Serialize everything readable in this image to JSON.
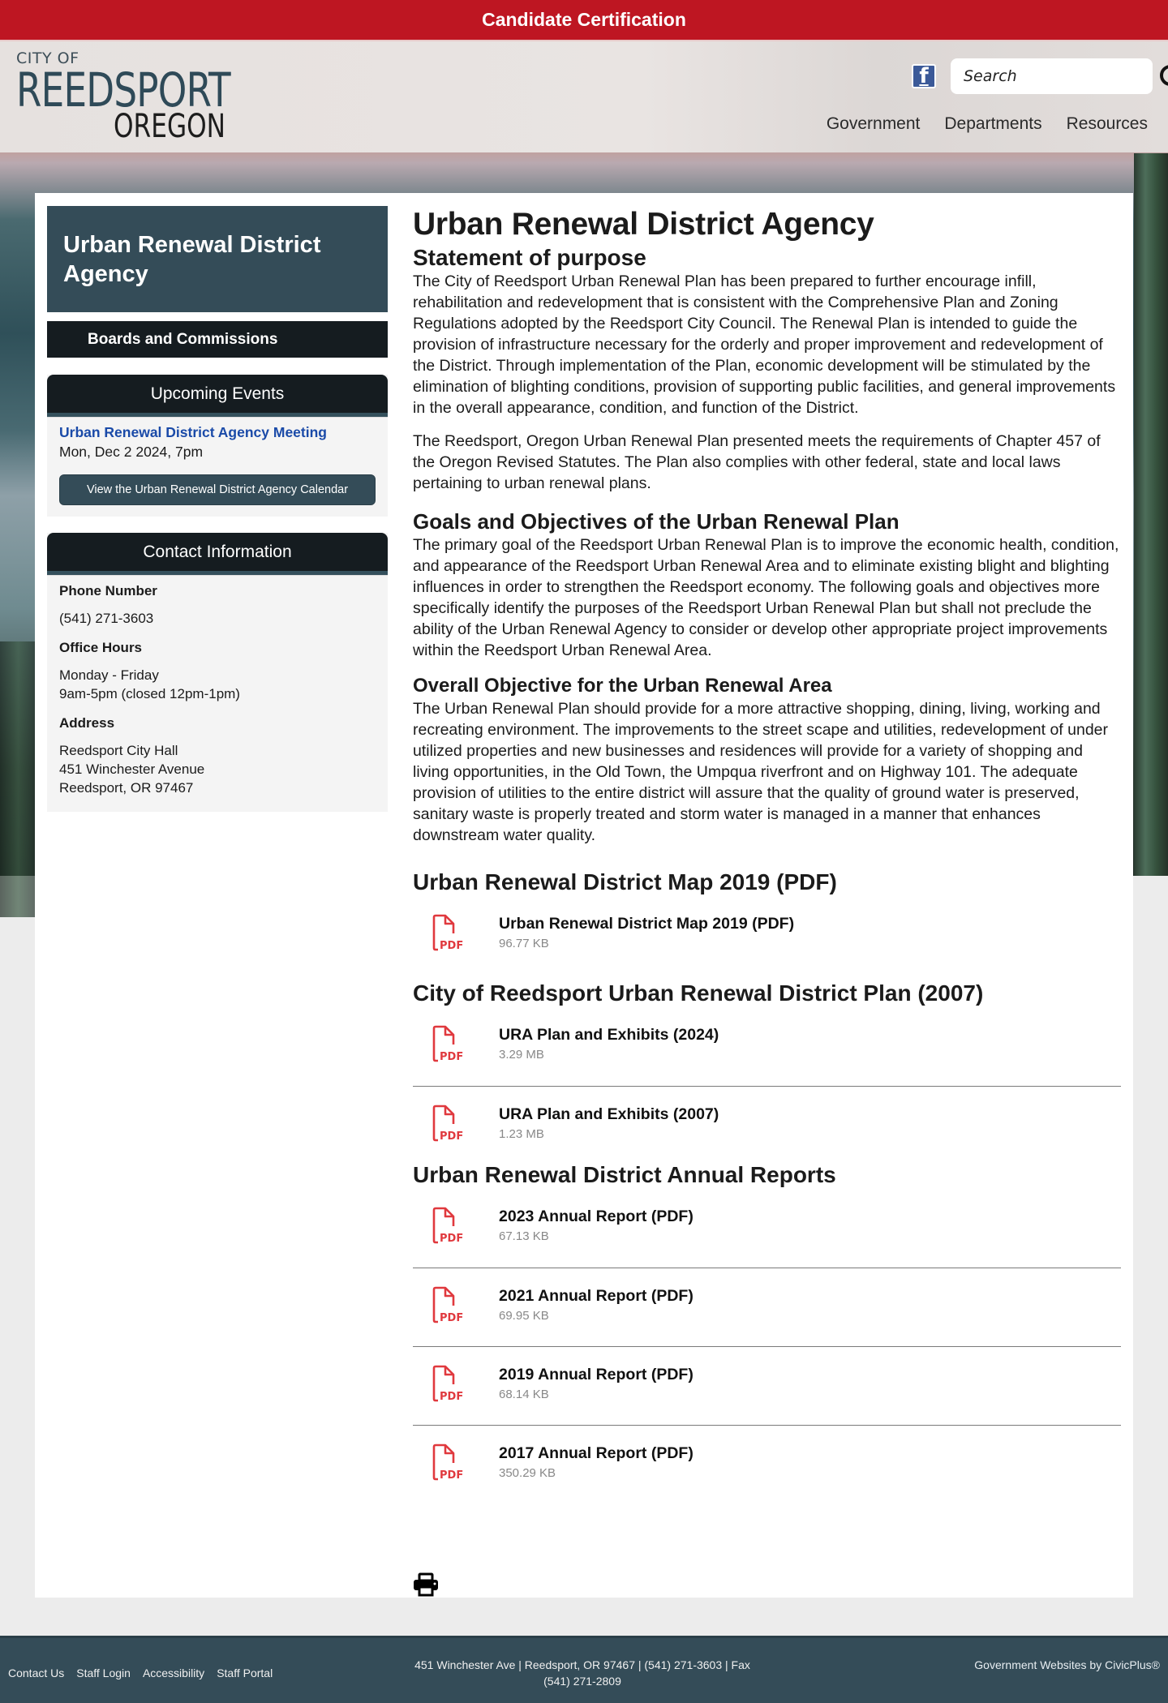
{
  "alert": {
    "label": "Candidate Certification",
    "color": "#be1622"
  },
  "logo": {
    "line1": "CITY OF",
    "line2": "REEDSPORT",
    "line3": "OREGON"
  },
  "header": {
    "social_icon": "facebook-icon",
    "search": {
      "placeholder": "Search",
      "value": "",
      "icon": "search-icon"
    },
    "nav": [
      "Government",
      "Departments",
      "Resources"
    ]
  },
  "sidebar": {
    "title": "Urban Renewal District Agency",
    "link": "Boards and Commissions",
    "events": {
      "heading": "Upcoming Events",
      "items": [
        {
          "title": "Urban Renewal District Agency Meeting",
          "date": "Mon, Dec 2 2024, 7pm"
        }
      ],
      "button": "View the Urban Renewal District Agency Calendar"
    },
    "contact": {
      "heading": "Contact Information",
      "phone_label": "Phone Number",
      "phone": "(541) 271-3603",
      "hours_label": "Office Hours",
      "hours_line1": "Monday - Friday",
      "hours_line2": "9am-5pm (closed 12pm-1pm)",
      "address_label": "Address",
      "address_line1": "Reedsport City Hall",
      "address_line2": "451 Winchester Avenue",
      "address_line3": "Reedsport, OR 97467"
    }
  },
  "main": {
    "title": "Urban Renewal District Agency",
    "purpose_heading": "Statement of purpose",
    "purpose_p1": "The City of Reedsport Urban Renewal Plan has been prepared to further encourage infill, rehabilitation and redevelopment that is consistent with the Comprehensive Plan and Zoning Regulations adopted by the Reedsport City Council. The Renewal Plan is intended to guide the provision of infrastructure necessary for the orderly and proper improvement and redevelopment of the District. Through implementation of the Plan, economic development will be stimulated by the elimination of blighting conditions, provision of supporting public facilities, and general improvements in the overall appearance, condition, and function of the District.",
    "purpose_p2": "The Reedsport, Oregon Urban Renewal Plan presented meets the requirements of Chapter 457 of the Oregon Revised Statutes. The Plan also complies with other federal, state and local laws pertaining to urban renewal plans.",
    "goals_heading": "Goals and Objectives of the Urban Renewal Plan",
    "goals_p": "The primary goal of the Reedsport Urban Renewal Plan is to improve the economic health, condition, and appearance of the Reedsport Urban Renewal Area and to eliminate existing blight and blighting influences in order to strengthen the Reedsport economy. The following goals and objectives more specifically identify the purposes of the Reedsport Urban Renewal Plan but shall not preclude the ability of the Urban Renewal Agency to consider or develop other appropriate project improvements within the Reedsport Urban Renewal Area.",
    "objective_heading": "Overall Objective for the Urban Renewal Area",
    "objective_p": "The Urban Renewal Plan should provide for a more attractive shopping, dining, living, working and recreating environment. The improvements to the street scape and utilities, redevelopment of under utilized properties and new businesses and residences will provide for a variety of shopping and living opportunities, in the Old Town, the Umpqua riverfront and on Highway 101.  The adequate provision of utilities to the entire district will assure that the quality of ground water is preserved, sanitary waste is properly treated and storm water is managed in a manner that enhances downstream water quality.",
    "doc_sections": [
      {
        "heading": "Urban Renewal District Map 2019 (PDF)",
        "docs": [
          {
            "title": "Urban Renewal District Map 2019 (PDF)",
            "size": "96.77 KB"
          }
        ]
      },
      {
        "heading": "City of Reedsport Urban Renewal District Plan (2007)",
        "docs": [
          {
            "title": "URA Plan and Exhibits (2024)",
            "size": "3.29 MB"
          },
          {
            "title": "URA Plan and Exhibits (2007)",
            "size": "1.23 MB"
          }
        ]
      },
      {
        "heading": "Urban Renewal District Annual Reports",
        "docs": [
          {
            "title": "2023 Annual Report (PDF)",
            "size": "67.13 KB"
          },
          {
            "title": "2021 Annual Report (PDF)",
            "size": "69.95 KB"
          },
          {
            "title": "2019 Annual Report (PDF)",
            "size": "68.14 KB"
          },
          {
            "title": "2017 Annual Report (PDF)",
            "size": "350.29 KB"
          }
        ]
      }
    ],
    "pdf_icon_label": "PDF",
    "pdf_icon_color": "#e0393e",
    "print_icon": "print-icon"
  },
  "footer": {
    "links": [
      "Contact Us",
      "Staff Login",
      "Accessibility",
      "Staff Portal"
    ],
    "address": "451 Winchester Ave | Reedsport, OR 97467 | (541) 271-3603 | Fax (541) 271-2809",
    "credit": "Government Websites by CivicPlus®"
  }
}
